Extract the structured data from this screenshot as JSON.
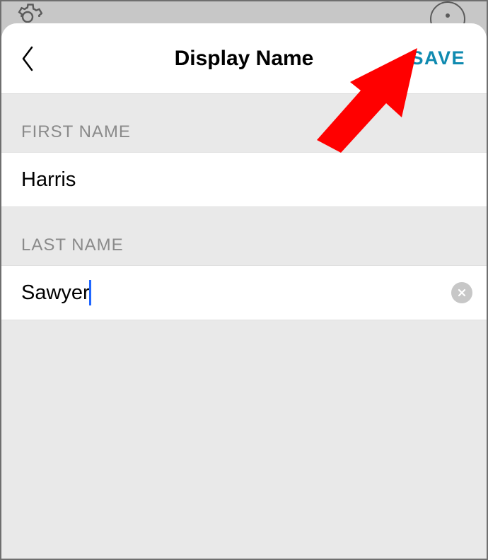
{
  "header": {
    "title": "Display Name",
    "save_label": "SAVE"
  },
  "first": {
    "label": "FIRST NAME",
    "value": "Harris"
  },
  "last": {
    "label": "LAST NAME",
    "value": "Sawyer"
  },
  "colors": {
    "accent": "#0f8ab0",
    "annotation": "#ff0000"
  }
}
